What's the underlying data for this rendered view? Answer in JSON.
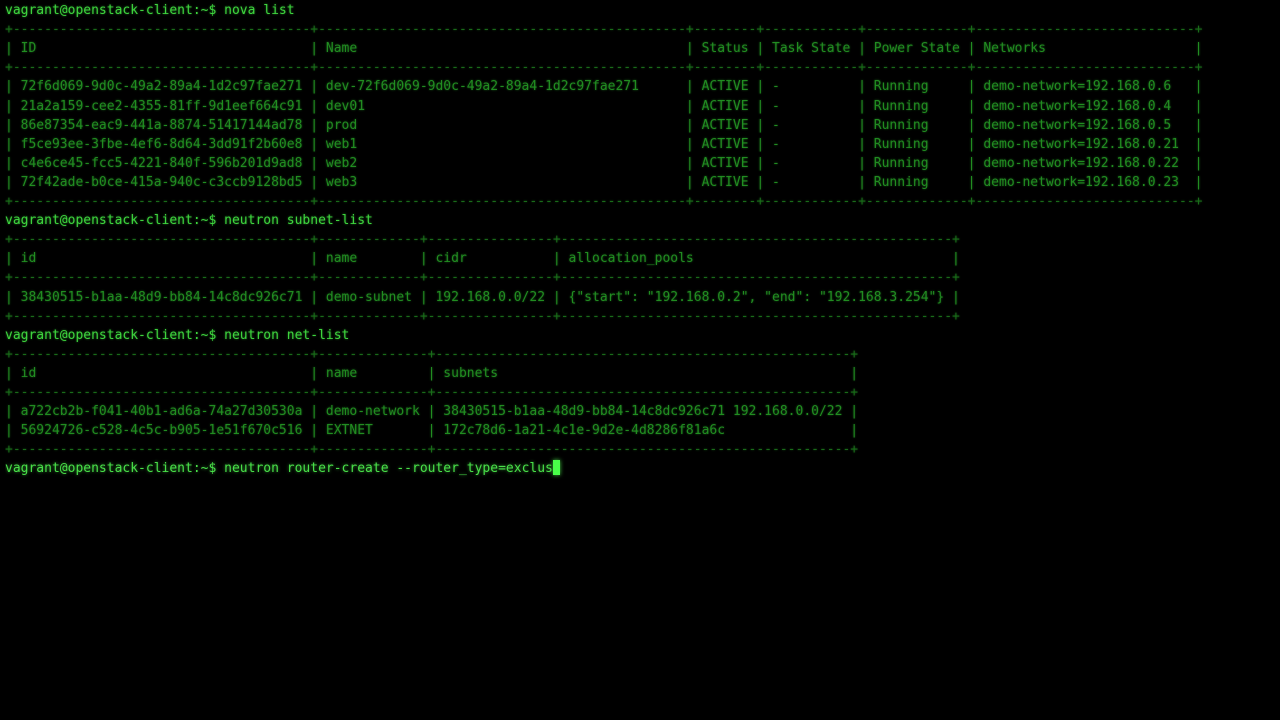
{
  "terminal": {
    "lines": [
      "vagrant@openstack-client:~$ nova list",
      "+--------------------------------------+-----------------------------------------------+--------+------------+-------------+----------------------------+",
      "| ID                                   | Name                                          | Status | Task State | Power State | Networks                   |",
      "+--------------------------------------+-----------------------------------------------+--------+------------+-------------+----------------------------+",
      "| 72f6d069-9d0c-49a2-89a4-1d2c97fae271 | dev-72f6d069-9d0c-49a2-89a4-1d2c97fae271      | ACTIVE | -          | Running     | demo-network=192.168.0.6   |",
      "| 21a2a159-cee2-4355-81ff-9d1eef664c91 | dev01                                         | ACTIVE | -          | Running     | demo-network=192.168.0.4   |",
      "| 86e87354-eac9-441a-8874-51417144ad78 | prod                                          | ACTIVE | -          | Running     | demo-network=192.168.0.5   |",
      "| f5ce93ee-3fbe-4ef6-8d64-3dd91f2b60e8 | web1                                          | ACTIVE | -          | Running     | demo-network=192.168.0.21  |",
      "| c4e6ce45-fcc5-4221-840f-596b201d9ad8 | web2                                          | ACTIVE | -          | Running     | demo-network=192.168.0.22  |",
      "| 72f42ade-b0ce-415a-940c-c3ccb9128bd5 | web3                                          | ACTIVE | -          | Running     | demo-network=192.168.0.23  |",
      "+--------------------------------------+-----------------------------------------------+--------+------------+-------------+----------------------------+",
      "vagrant@openstack-client:~$ neutron subnet-list",
      "+--------------------------------------+-------------+----------------+--------------------------------------------------+",
      "| id                                   | name        | cidr           | allocation_pools                                 |",
      "+--------------------------------------+-------------+----------------+--------------------------------------------------+",
      "| 38430515-b1aa-48d9-bb84-14c8dc926c71 | demo-subnet | 192.168.0.0/22 | {\"start\": \"192.168.0.2\", \"end\": \"192.168.3.254\"} |",
      "+--------------------------------------+-------------+----------------+--------------------------------------------------+",
      "vagrant@openstack-client:~$ neutron net-list",
      "+--------------------------------------+--------------+-----------------------------------------------------+",
      "| id                                   | name         | subnets                                             |",
      "+--------------------------------------+--------------+-----------------------------------------------------+",
      "| a722cb2b-f041-40b1-ad6a-74a27d30530a | demo-network | 38430515-b1aa-48d9-bb84-14c8dc926c71 192.168.0.0/22 |",
      "| 56924726-c528-4c5c-b905-1e51f670c516 | EXTNET       | 172c78d6-1a21-4c1e-9d2e-4d8286f81a6c                |",
      "+--------------------------------------+--------------+-----------------------------------------------------+"
    ],
    "prompt": "vagrant@openstack-client:~$ ",
    "current_input": "neutron router-create --router_type=exclus"
  }
}
